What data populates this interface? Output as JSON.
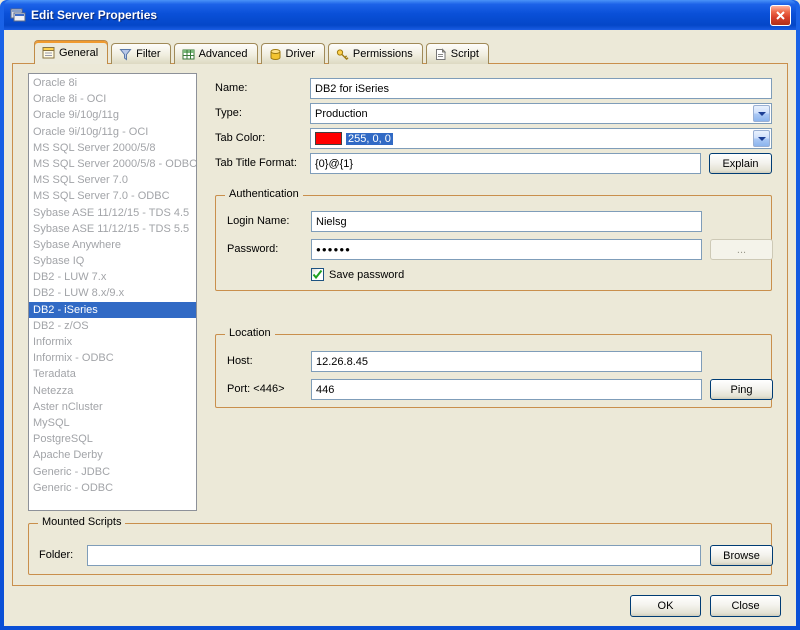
{
  "window": {
    "title": "Edit Server Properties"
  },
  "tabs": [
    {
      "label": "General",
      "active": true
    },
    {
      "label": "Filter",
      "active": false
    },
    {
      "label": "Advanced",
      "active": false
    },
    {
      "label": "Driver",
      "active": false
    },
    {
      "label": "Permissions",
      "active": false
    },
    {
      "label": "Script",
      "active": false
    }
  ],
  "server_list": {
    "items": [
      "Oracle 8i",
      "Oracle 8i - OCI",
      "Oracle 9i/10g/11g",
      "Oracle 9i/10g/11g - OCI",
      "MS SQL Server 2000/5/8",
      "MS SQL Server 2000/5/8 - ODBC",
      "MS SQL Server 7.0",
      "MS SQL Server 7.0 - ODBC",
      "Sybase ASE 11/12/15 - TDS 4.5",
      "Sybase ASE 11/12/15 - TDS 5.5",
      "Sybase Anywhere",
      "Sybase IQ",
      "DB2 - LUW 7.x",
      "DB2 - LUW 8.x/9.x",
      "DB2 - iSeries",
      "DB2 - z/OS",
      "Informix",
      "Informix - ODBC",
      "Teradata",
      "Netezza",
      "Aster nCluster",
      "MySQL",
      "PostgreSQL",
      "Apache Derby",
      "Generic - JDBC",
      "Generic - ODBC"
    ],
    "selected": "DB2 - iSeries"
  },
  "general": {
    "name": {
      "label": "Name:",
      "value": "DB2 for iSeries"
    },
    "type": {
      "label": "Type:",
      "value": "Production"
    },
    "tab_color": {
      "label": "Tab Color:",
      "value": "255, 0, 0",
      "swatch_color": "#ff0000"
    },
    "tab_title_format": {
      "label": "Tab Title Format:",
      "value": "{0}@{1}",
      "explain_button": "Explain"
    },
    "authentication": {
      "title": "Authentication",
      "login_name": {
        "label": "Login Name:",
        "value": "Nielsg"
      },
      "password": {
        "label": "Password:",
        "value": "●●●●●●",
        "browse_button": "..."
      },
      "save_password": {
        "label": "Save password",
        "checked": true
      }
    },
    "location": {
      "title": "Location",
      "host": {
        "label": "Host:",
        "value": "12.26.8.45"
      },
      "port": {
        "label": "Port: <446>",
        "value": "446",
        "ping_button": "Ping"
      }
    },
    "mounted_scripts": {
      "title": "Mounted Scripts",
      "folder": {
        "label": "Folder:",
        "value": "",
        "browse_button": "Browse"
      }
    }
  },
  "footer": {
    "ok_button": "OK",
    "close_button": "Close"
  },
  "colors": {
    "selection": "#316ac5",
    "tab_color_swatch": "#ff0000",
    "titlebar": "#0a50d8"
  }
}
